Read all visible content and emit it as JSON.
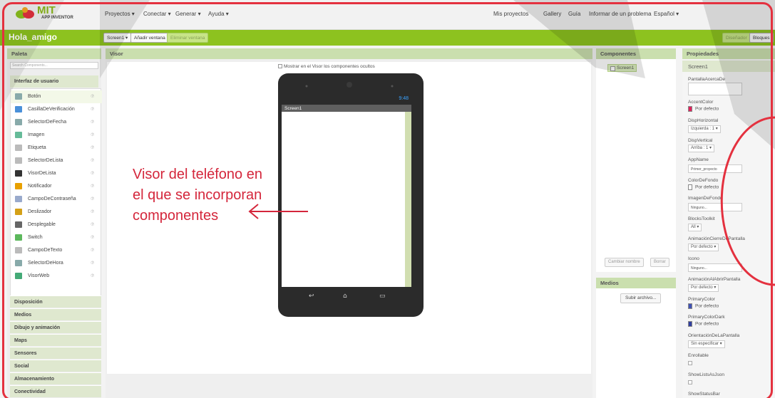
{
  "topbar": {
    "logo_text": "MIT",
    "logo_sub": "APP INVENTOR",
    "menu": [
      "Proyectos ▾",
      "Conectar ▾",
      "Generar ▾",
      "Ayuda ▾"
    ],
    "right_links": [
      "Mis proyectos",
      "Gallery",
      "Guía",
      "Informar de un problema",
      "Español ▾"
    ]
  },
  "projectbar": {
    "project_name": "Hola_amigo",
    "screen_select": "Screen1 ▾",
    "add_window": "Añadir ventana",
    "remove_window": "Eliminar ventana",
    "designer": "Diseñador",
    "blocks": "Bloques"
  },
  "paleta": {
    "title": "Paleta",
    "search_placeholder": "Search Components...",
    "category_open": "Interfaz de usuario",
    "items": [
      {
        "label": "Botón",
        "icon": "button-icon"
      },
      {
        "label": "CasillaDeVerificación",
        "icon": "checkbox-icon"
      },
      {
        "label": "SelectorDeFecha",
        "icon": "date-picker-icon"
      },
      {
        "label": "Imagen",
        "icon": "image-icon"
      },
      {
        "label": "Etiqueta",
        "icon": "label-icon"
      },
      {
        "label": "SelectorDeLista",
        "icon": "list-picker-icon"
      },
      {
        "label": "VisorDeLista",
        "icon": "list-view-icon"
      },
      {
        "label": "Notificador",
        "icon": "notifier-icon"
      },
      {
        "label": "CampoDeContraseña",
        "icon": "password-icon"
      },
      {
        "label": "Deslizador",
        "icon": "slider-icon"
      },
      {
        "label": "Desplegable",
        "icon": "spinner-icon"
      },
      {
        "label": "Switch",
        "icon": "switch-icon"
      },
      {
        "label": "CampoDeTexto",
        "icon": "textbox-icon"
      },
      {
        "label": "SelectorDeHora",
        "icon": "time-picker-icon"
      },
      {
        "label": "VisorWeb",
        "icon": "webviewer-icon"
      }
    ],
    "categories": [
      "Disposición",
      "Medios",
      "Dibujo y animación",
      "Maps",
      "Sensores",
      "Social",
      "Almacenamiento",
      "Conectividad"
    ]
  },
  "visor": {
    "title": "Visor",
    "show_hidden": "Mostrar en el Visor los componentes ocultos",
    "phone_time": "9:48",
    "screen_title": "Screen1",
    "annotation": "Visor del teléfono en el que se incorporan componentes"
  },
  "componentes": {
    "title": "Componentes",
    "screen1": "Screen1",
    "rename": "Cambiar nombre",
    "delete": "Borrar"
  },
  "medios": {
    "title": "Medios",
    "upload": "Subir archivo..."
  },
  "propiedades": {
    "title": "Propiedades",
    "screen": "Screen1",
    "props": {
      "pantalla_acerca": "PantallaAcercaDe",
      "accent_label": "AccentColor",
      "accent_value": "Por defecto",
      "disp_h_label": "DispHorizontal",
      "disp_h_value": "Izquierda : 1 ▾",
      "disp_v_label": "DispVertical",
      "disp_v_value": "Arriba : 1 ▾",
      "appname_label": "AppName",
      "appname_value": "Primer_proyecto",
      "colorfondo_label": "ColorDeFondo",
      "colorfondo_value": "Por defecto",
      "imagenfondo_label": "ImagenDeFondo",
      "imagenfondo_value": "Ninguno...",
      "blocks_label": "BlocksToolkit",
      "blocks_value": "All ▾",
      "anim_cierre_label": "AnimaciónCierreDePantalla",
      "anim_cierre_value": "Por defecto ▾",
      "icono_label": "Icono",
      "icono_value": "Ninguno...",
      "anim_abrir_label": "AnimaciónAlAbrirPantalla",
      "anim_abrir_value": "Por defecto ▾",
      "primary_label": "PrimaryColor",
      "primary_value": "Por defecto",
      "primary_dark_label": "PrimaryColorDark",
      "primary_dark_value": "Por defecto",
      "orient_label": "OrientaciónDeLaPantalla",
      "orient_value": "Sin especificar ▾",
      "enrollable_label": "Enrollable",
      "showlists_label": "ShowListsAsJson",
      "showstatus_label": "ShowStatusBar"
    }
  },
  "colors": {
    "accent_green": "#8dc21f",
    "annotation_red": "#d4263b",
    "accent_color": "#e0205a",
    "primary_color": "#3f51b5",
    "primary_dark": "#303f9f"
  }
}
